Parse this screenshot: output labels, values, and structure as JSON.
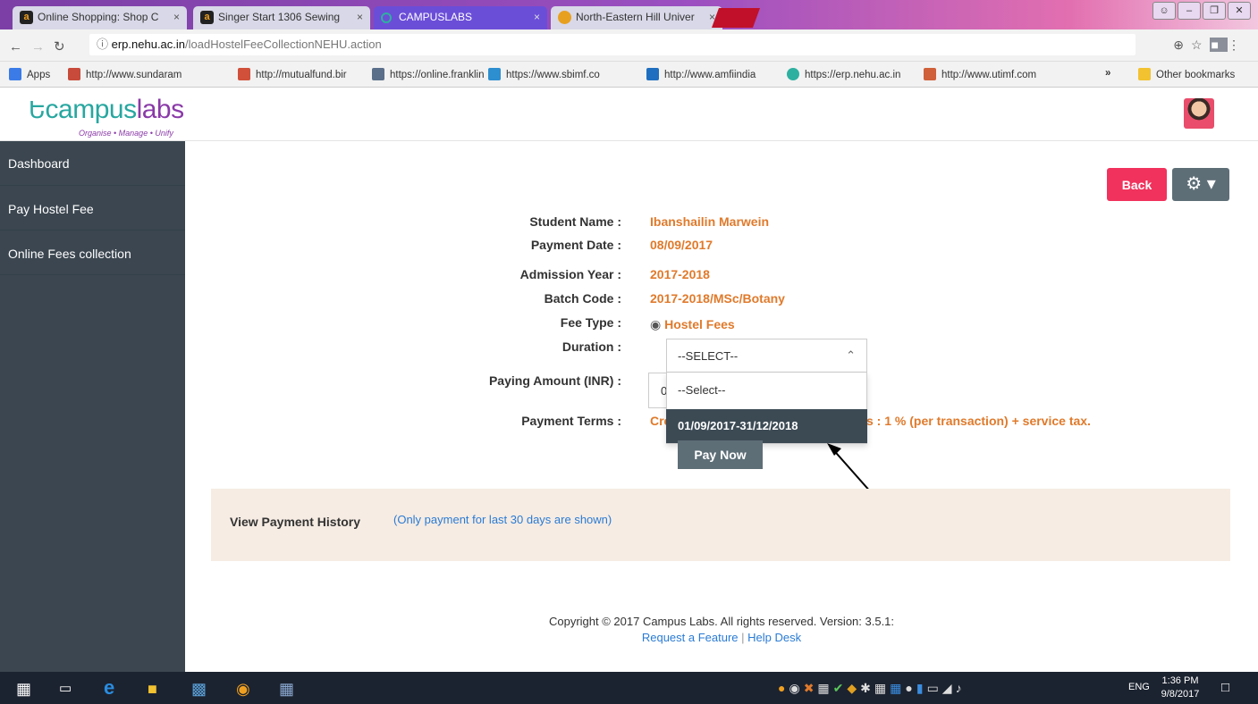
{
  "browser": {
    "tabs": [
      {
        "title": "Online Shopping: Shop C",
        "icon": "amazon-icon",
        "active": false
      },
      {
        "title": "Singer Start 1306 Sewing",
        "icon": "amazon-icon",
        "active": false
      },
      {
        "title": "CAMPUSLABS",
        "icon": "campuslabs-icon",
        "active": true
      },
      {
        "title": "North-Eastern Hill Univer",
        "icon": "nehu-icon",
        "active": false
      }
    ],
    "tab_icon_letter": "a",
    "close_glyph": "×",
    "url_host": "erp.nehu.ac.in",
    "url_path": "/loadHostelFeeCollectionNEHU.action",
    "bookmarks": [
      "Apps",
      "http://www.sundaram",
      "http://mutualfund.bir",
      "https://online.franklin",
      "https://www.sbimf.co",
      "http://www.amfiindia",
      "https://erp.nehu.ac.in",
      "http://www.utimf.com"
    ],
    "bookmarks_overflow": "»",
    "other_bookmarks": "Other bookmarks"
  },
  "app": {
    "logo_text_a": "campus",
    "logo_text_b": "labs",
    "tagline": "Organise • Manage • Unify"
  },
  "sidebar": {
    "items": [
      {
        "label": "Dashboard"
      },
      {
        "label": "Pay Hostel Fee"
      },
      {
        "label": "Online Fees collection"
      }
    ]
  },
  "toolbar": {
    "back_label": "Back",
    "gear_label": "⚙ ▾"
  },
  "form": {
    "student_name_label": "Student Name :",
    "student_name": "Ibanshailin Marwein",
    "payment_date_label": "Payment Date :",
    "payment_date": "08/09/2017",
    "admission_year_label": "Admission Year :",
    "admission_year": "2017-2018",
    "batch_code_label": "Batch Code :",
    "batch_code": "2017-2018/MSc/Botany",
    "fee_type_label": "Fee Type :",
    "fee_type": "Hostel Fees",
    "duration_label": "Duration :",
    "duration_selected": "--SELECT--",
    "duration_options": [
      "--Select--",
      "01/09/2017-31/12/2018"
    ],
    "paying_amount_label": "Paying Amount (INR) :",
    "paying_amount": "0",
    "payment_terms_label": "Payment Terms :",
    "payment_terms_start": "Cre",
    "payment_terms_end": "s : 1 % (per transaction) + service tax.",
    "pay_now_label": "Pay Now"
  },
  "history": {
    "title": "View Payment History",
    "note": "(Only payment for last 30 days are shown)"
  },
  "footer": {
    "copyright": "Copyright © 2017 Campus Labs. All rights reserved. Version: 3.5.1:",
    "request_feature": "Request a Feature",
    "separator": "|",
    "help_desk": "Help Desk"
  },
  "taskbar": {
    "lang": "ENG",
    "time": "1:36 PM",
    "date": "9/8/2017"
  },
  "colors": {
    "sidebar_bg": "#3b4650",
    "value_orange": "#e07a2b",
    "back_red": "#f0325c",
    "link_blue": "#2a7bd4",
    "history_bg": "#f6ece3"
  }
}
